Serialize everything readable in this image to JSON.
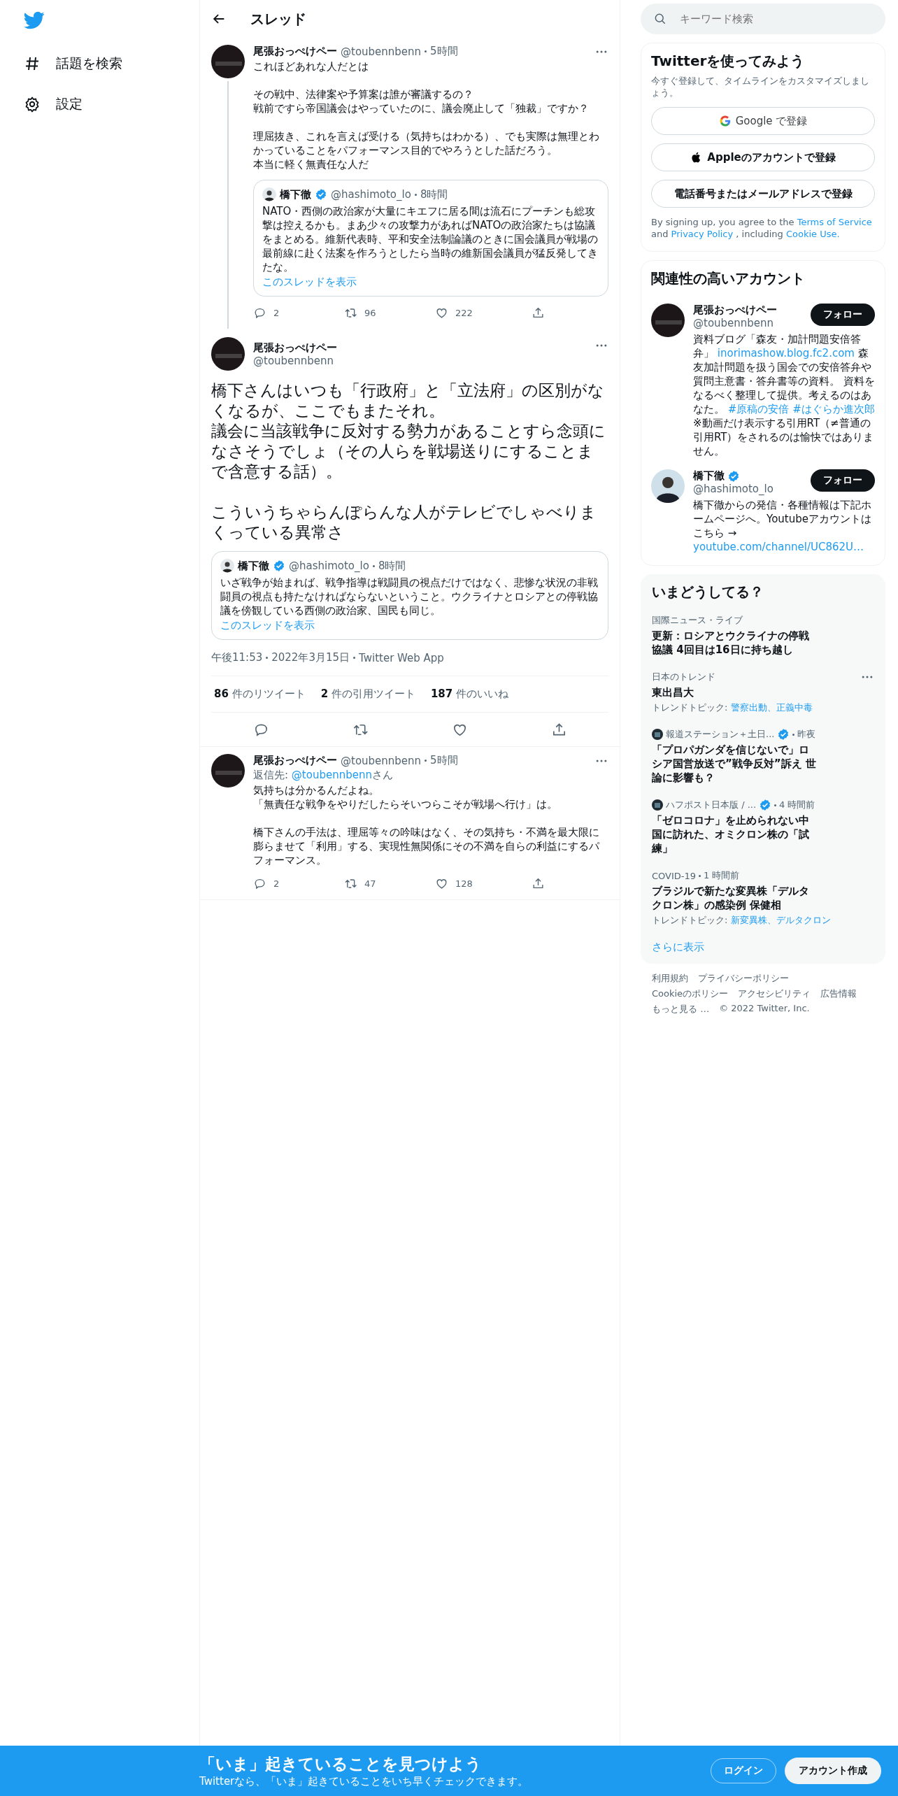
{
  "nav": [
    {
      "kind": "hashtag",
      "label": "話題を検索"
    },
    {
      "kind": "gear",
      "label": "設定"
    }
  ],
  "header": {
    "title": "スレッド"
  },
  "tweets": [
    {
      "kind": "reply",
      "name": "尾張おっぺけペー",
      "handle": "@toubennbenn",
      "time": "5時間",
      "thread_line": true,
      "paragraphs": [
        [
          "これほどあれな人だとは"
        ],
        [
          "その戦中、法律案や予算案は誰が審議するの？",
          "戦前ですら帝国議会はやっていたのに、議会廃止して「独裁」ですか？"
        ],
        [
          "理屈抜き、これを言えば受ける（気持ちはわかる）、でも実際は無理とわかっていることをパフォーマンス目的でやろうとした話だろう。",
          "本当に軽く無責任な人だ"
        ]
      ],
      "quote": {
        "name": "橋下徹",
        "verified": true,
        "handle": "@hashimoto_lo",
        "time": "8時間",
        "text": "NATO・西側の政治家が大量にキエフに居る間は流石にプーチンも総攻撃は控えるかも。まあ少々の攻撃力があればNATOの政治家たちは協議をまとめる。維新代表時、平和安全法制論議のときに国会議員が戦場の最前線に赴く法案を作ろうとしたら当時の維新国会議員が猛反発してきたな。",
        "link": "このスレッドを表示"
      },
      "counts": {
        "reply": "2",
        "retweet": "96",
        "like": "222"
      }
    },
    {
      "kind": "focus",
      "name": "尾張おっぺけペー",
      "handle": "@toubennbenn",
      "paragraphs": [
        [
          "橋下さんはいつも「行政府」と「立法府」の区別がなくなるが、ここでもまたそれ。",
          "議会に当該戦争に反対する勢力があることすら念頭になさそうでしょ（その人らを戦場送りにすることまで含意する話）。"
        ],
        [
          "こういうちゃらんぽらんな人がテレビでしゃべりまくっている異常さ"
        ]
      ],
      "quote": {
        "name": "橋下徹",
        "verified": true,
        "handle": "@hashimoto_lo",
        "time": "8時間",
        "text": "いざ戦争が始まれば、戦争指導は戦闘員の視点だけではなく、悲惨な状況の非戦闘員の視点も持たなければならないということ。ウクライナとロシアとの停戦協議を傍観している西側の政治家、国民も同じ。",
        "link": "このスレッドを表示"
      },
      "timestamp": [
        "午後11:53",
        "2022年3月15日",
        "Twitter Web App"
      ],
      "stats": [
        {
          "count": "86",
          "label": "件のリツイート"
        },
        {
          "count": "2",
          "label": "件の引用ツイート"
        },
        {
          "count": "187",
          "label": "件のいいね"
        }
      ]
    },
    {
      "kind": "reply",
      "name": "尾張おっぺけペー",
      "handle": "@toubennbenn",
      "time": "5時間",
      "reply_to": {
        "prefix": "返信先: ",
        "handle": "@toubennbenn",
        "suffix": "さん"
      },
      "paragraphs": [
        [
          "気持ちは分かるんだよね。",
          "「無責任な戦争をやりだしたらそいつらこそが戦場へ行け」は。"
        ],
        [
          "橋下さんの手法は、理屈等々の吟味はなく、その気持ち・不満を最大限に膨らませて「利用」する、実現性無関係にその不満を自らの利益にするパフォーマンス。"
        ]
      ],
      "counts": {
        "reply": "2",
        "retweet": "47",
        "like": "128"
      }
    }
  ],
  "search": {
    "placeholder": "キーワード検索"
  },
  "signup": {
    "title": "Twitterを使ってみよう",
    "subtitle": "今すぐ登録して、タイムラインをカスタマイズしましょう。",
    "buttons": [
      {
        "kind": "google",
        "label": "Google で登録"
      },
      {
        "kind": "apple",
        "label": "Appleのアカウントで登録"
      },
      {
        "kind": "plain",
        "label": "電話番号またはメールアドレスで登録"
      }
    ],
    "legal": [
      {
        "kind": "text",
        "text": "By signing up, you agree to the"
      },
      {
        "kind": "link",
        "text": "Terms of Service"
      },
      {
        "kind": "text",
        "text": "and"
      },
      {
        "kind": "link",
        "text": "Privacy Policy"
      },
      {
        "kind": "text",
        "text": ", including"
      },
      {
        "kind": "link",
        "text": "Cookie Use."
      }
    ]
  },
  "accounts": {
    "title": "関連性の高いアカウント",
    "items": [
      {
        "kind": "dark",
        "name": "尾張おっぺけペー",
        "handle": "@toubennbenn",
        "button": "フォロー",
        "bio": [
          {
            "kind": "text",
            "text": "資料ブログ「森友・加計問題安倍答弁」"
          },
          {
            "kind": "link",
            "text": "inorimashow.blog.fc2.com"
          },
          {
            "kind": "text",
            "text": "森友加計問題を扱う国会での安倍答弁や質問主意書・答弁書等の資料。 資料をなるべく整理して提供。考えるのはあなた。"
          },
          {
            "kind": "link",
            "text": "#原稿の安倍"
          },
          {
            "kind": "link",
            "text": "#はぐらか進次郎"
          },
          {
            "kind": "text",
            "text": "※動画だけ表示する引用RT（≠普通の引用RT）をされるのは愉快ではありません。"
          }
        ]
      },
      {
        "kind": "person",
        "name": "橋下徹",
        "verified": true,
        "handle": "@hashimoto_lo",
        "button": "フォロー",
        "bio": [
          {
            "kind": "text",
            "text": "橋下徹からの発信・各種情報は下記ホームページへ。Youtubeアカウントはこちら →"
          },
          {
            "kind": "link",
            "text": "youtube.com/channel/UC862U…"
          }
        ]
      }
    ]
  },
  "trends": {
    "title": "いまどうしてる？",
    "items": [
      {
        "kind": "news",
        "context": "国際ニュース・ライブ",
        "headline": "更新：ロシアとウクライナの停戦協議 4回目は16日に持ち越し"
      },
      {
        "kind": "trend",
        "context": "日本のトレンド",
        "headline": "東出昌大",
        "topics_label": "トレンドトピック:",
        "topics": "警察出動、正義中毒",
        "menu": true
      },
      {
        "kind": "media",
        "source": "報道ステーション＋土日...",
        "verified": true,
        "time": "昨夜",
        "headline": "「プロパガンダを信じないで」ロシア国営放送で”戦争反対”訴え 世論に影響も？"
      },
      {
        "kind": "media",
        "source": "ハフポスト日本版 / ...",
        "verified": true,
        "time": "4 時間前",
        "headline": "「ゼロコロナ」を止められない中国に訪れた、オミクロン株の「試練」"
      },
      {
        "kind": "topic",
        "context": "COVID-19",
        "time": "1 時間前",
        "headline": "ブラジルで新たな変異株「デルタクロン株」の感染例 保健相",
        "topics_label": "トレンドトピック:",
        "topics": "新変異株、デルタクロン"
      }
    ],
    "more": "さらに表示"
  },
  "footer": {
    "links": [
      "利用規約",
      "プライバシーポリシー",
      "Cookieのポリシー",
      "アクセシビリティ",
      "広告情報",
      "もっと見る …"
    ],
    "copyright": "© 2022 Twitter, Inc."
  },
  "banner": {
    "title": "「いま」起きていることを見つけよう",
    "subtitle": "Twitterなら、「いま」起きていることをいち早くチェックできます。",
    "login": "ログイン",
    "signup": "アカウント作成"
  }
}
